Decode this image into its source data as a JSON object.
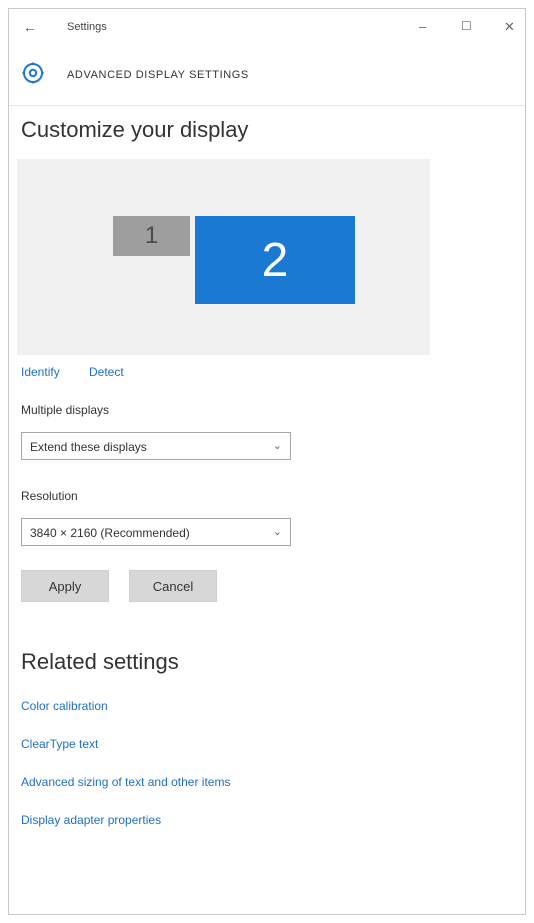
{
  "window": {
    "app_title": "Settings",
    "back_glyph": "←",
    "minimize_glyph": "–",
    "maximize_glyph": "☐",
    "close_glyph": "✕"
  },
  "header": {
    "title": "ADVANCED DISPLAY SETTINGS",
    "icon": "gear-icon"
  },
  "customize": {
    "title": "Customize your display",
    "monitors": [
      {
        "label": "1",
        "color": "#9e9e9e"
      },
      {
        "label": "2",
        "color": "#1979d3"
      }
    ],
    "identify_label": "Identify",
    "detect_label": "Detect"
  },
  "multiple_displays": {
    "label": "Multiple displays",
    "value": "Extend these displays"
  },
  "resolution": {
    "label": "Resolution",
    "value": "3840 × 2160 (Recommended)"
  },
  "buttons": {
    "apply": "Apply",
    "cancel": "Cancel"
  },
  "related": {
    "title": "Related settings",
    "links": [
      "Color calibration",
      "ClearType text",
      "Advanced sizing of text and other items",
      "Display adapter properties"
    ]
  },
  "colors": {
    "accent": "#1979d3",
    "link": "#1f70c4"
  }
}
